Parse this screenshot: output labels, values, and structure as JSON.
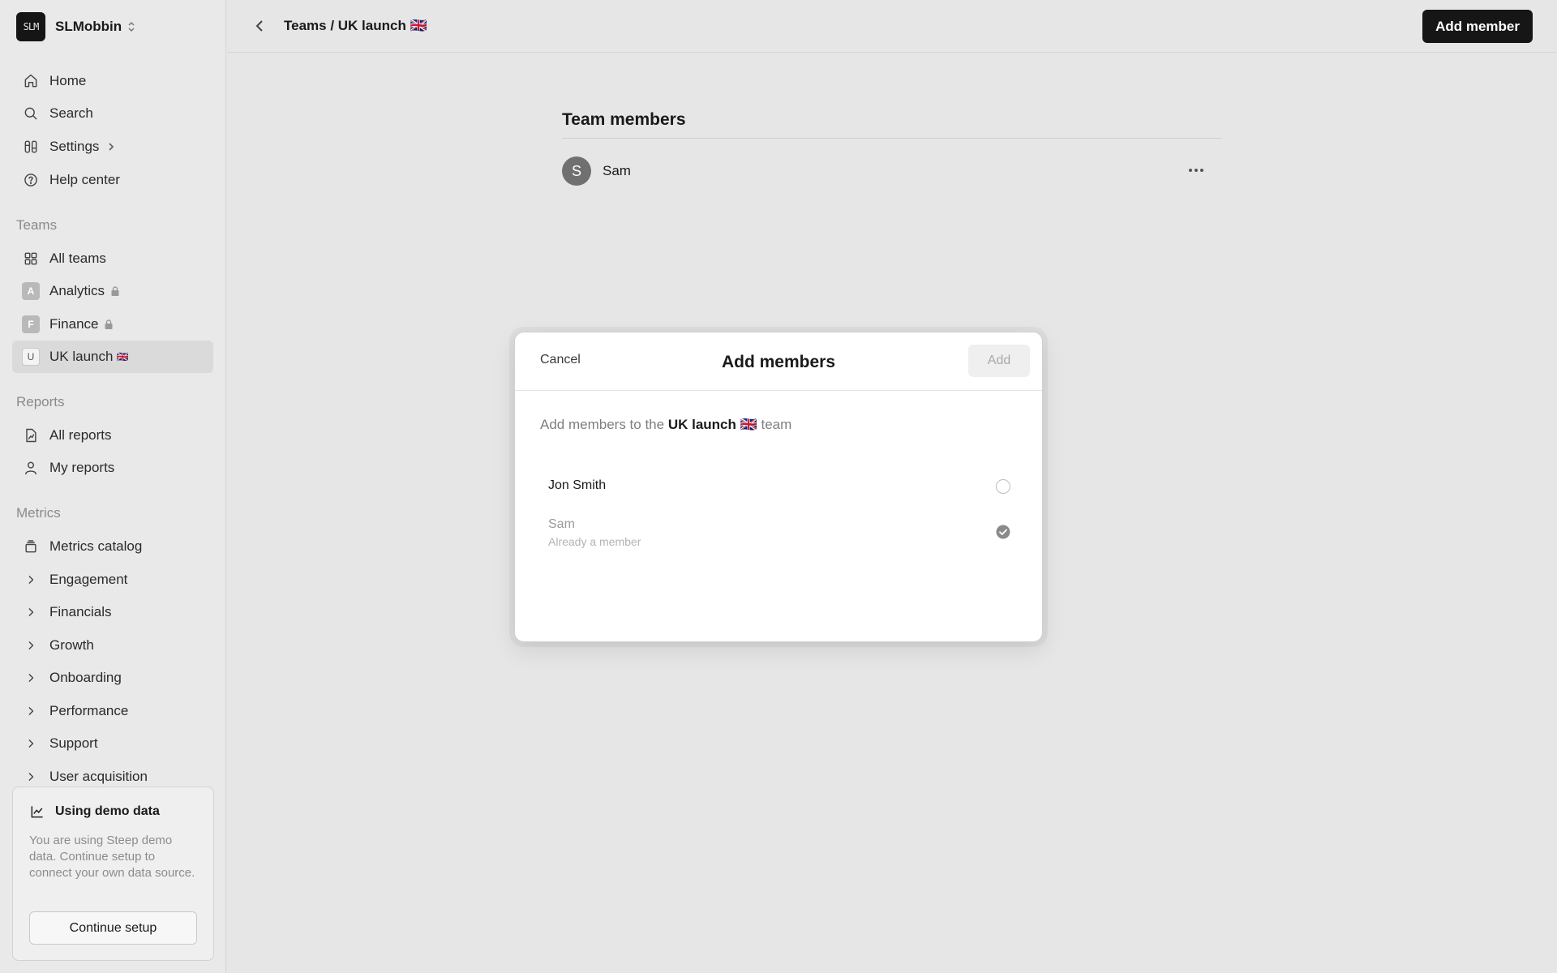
{
  "workspace": {
    "logo_text": "SLM",
    "name": "SLMobbin"
  },
  "nav": {
    "home": "Home",
    "search": "Search",
    "settings": "Settings",
    "help": "Help center"
  },
  "teams": {
    "title": "Teams",
    "all": "All teams",
    "items": [
      {
        "initial": "A",
        "label": "Analytics",
        "locked": true
      },
      {
        "initial": "F",
        "label": "Finance",
        "locked": true
      },
      {
        "initial": "U",
        "label": "UK launch",
        "flag": "🇬🇧",
        "active": true
      }
    ]
  },
  "reports": {
    "title": "Reports",
    "all": "All reports",
    "mine": "My reports"
  },
  "metrics": {
    "title": "Metrics",
    "catalog": "Metrics catalog",
    "groups": [
      "Engagement",
      "Financials",
      "Growth",
      "Onboarding",
      "Performance",
      "Support",
      "User acquisition"
    ]
  },
  "demo": {
    "title": "Using demo data",
    "text": "You are using Steep demo data. Continue setup to connect your own data source.",
    "button": "Continue setup"
  },
  "header": {
    "breadcrumb": "Teams / UK launch 🇬🇧",
    "add_member": "Add member"
  },
  "team_members": {
    "title": "Team members",
    "members": [
      {
        "initial": "S",
        "name": "Sam"
      }
    ]
  },
  "modal": {
    "cancel": "Cancel",
    "title": "Add members",
    "add": "Add",
    "desc_prefix": "Add members to the",
    "team_name": "UK launch 🇬🇧",
    "desc_suffix": "team",
    "options": [
      {
        "name": "Jon Smith",
        "selected": false,
        "disabled": false
      },
      {
        "name": "Sam",
        "subtitle": "Already a member",
        "selected": true,
        "disabled": true
      }
    ]
  }
}
